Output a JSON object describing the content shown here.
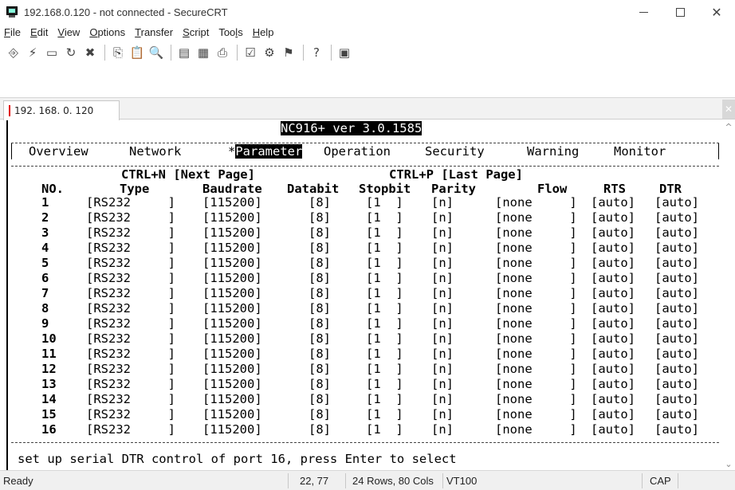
{
  "window": {
    "title": "192.168.0.120 - not connected - SecureCRT",
    "minimize_icon": "minimize-icon",
    "maximize_icon": "maximize-icon",
    "close_icon": "close-icon"
  },
  "menu": [
    {
      "pre": "",
      "mnemonic": "F",
      "post": "ile"
    },
    {
      "pre": "",
      "mnemonic": "E",
      "post": "dit"
    },
    {
      "pre": "",
      "mnemonic": "V",
      "post": "iew"
    },
    {
      "pre": "",
      "mnemonic": "O",
      "post": "ptions"
    },
    {
      "pre": "",
      "mnemonic": "T",
      "post": "ransfer"
    },
    {
      "pre": "",
      "mnemonic": "S",
      "post": "cript"
    },
    {
      "pre": "Too",
      "mnemonic": "l",
      "post": "s"
    },
    {
      "pre": "",
      "mnemonic": "H",
      "post": "elp"
    }
  ],
  "toolbar": {
    "groups": [
      [
        "connect-icon",
        "quick-connect-icon",
        "connect-in-tab-icon",
        "reconnect-icon",
        "disconnect-icon"
      ],
      [
        "copy-icon",
        "paste-icon",
        "find-icon"
      ],
      [
        "print-screen-icon",
        "print-selection-icon",
        "print-icon"
      ],
      [
        "session-options-icon",
        "global-options-icon",
        "keymap-icon"
      ],
      [
        "help-icon"
      ],
      [
        "sftp-icon"
      ]
    ]
  },
  "tab": {
    "label": "192. 168. 0. 120",
    "close_glyph": "✕"
  },
  "terminal": {
    "header": "NC916+ ver 3.0.1585",
    "nav_tabs": [
      "Overview",
      "Network",
      "*Parameter",
      "Operation",
      "Security",
      "Warning",
      "Monitor"
    ],
    "active_tab": "Parameter",
    "next_page": "CTRL+N [Next Page]",
    "last_page": "CTRL+P [Last Page]",
    "columns": {
      "no": "NO.",
      "type": "Type",
      "baudrate": "Baudrate",
      "databit": "Databit",
      "stopbit": "Stopbit",
      "parity": "Parity",
      "flow": "Flow",
      "rts": "RTS",
      "dtr": "DTR"
    },
    "rows": [
      {
        "no": "1",
        "type": "[RS232     ]",
        "baud": "[115200]",
        "databit": "[8]",
        "stopbit": "[1  ]",
        "parity": "[n]",
        "flow": "[none     ]",
        "rts": "[auto]",
        "dtr": "[auto]"
      },
      {
        "no": "2",
        "type": "[RS232     ]",
        "baud": "[115200]",
        "databit": "[8]",
        "stopbit": "[1  ]",
        "parity": "[n]",
        "flow": "[none     ]",
        "rts": "[auto]",
        "dtr": "[auto]"
      },
      {
        "no": "3",
        "type": "[RS232     ]",
        "baud": "[115200]",
        "databit": "[8]",
        "stopbit": "[1  ]",
        "parity": "[n]",
        "flow": "[none     ]",
        "rts": "[auto]",
        "dtr": "[auto]"
      },
      {
        "no": "4",
        "type": "[RS232     ]",
        "baud": "[115200]",
        "databit": "[8]",
        "stopbit": "[1  ]",
        "parity": "[n]",
        "flow": "[none     ]",
        "rts": "[auto]",
        "dtr": "[auto]"
      },
      {
        "no": "5",
        "type": "[RS232     ]",
        "baud": "[115200]",
        "databit": "[8]",
        "stopbit": "[1  ]",
        "parity": "[n]",
        "flow": "[none     ]",
        "rts": "[auto]",
        "dtr": "[auto]"
      },
      {
        "no": "6",
        "type": "[RS232     ]",
        "baud": "[115200]",
        "databit": "[8]",
        "stopbit": "[1  ]",
        "parity": "[n]",
        "flow": "[none     ]",
        "rts": "[auto]",
        "dtr": "[auto]"
      },
      {
        "no": "7",
        "type": "[RS232     ]",
        "baud": "[115200]",
        "databit": "[8]",
        "stopbit": "[1  ]",
        "parity": "[n]",
        "flow": "[none     ]",
        "rts": "[auto]",
        "dtr": "[auto]"
      },
      {
        "no": "8",
        "type": "[RS232     ]",
        "baud": "[115200]",
        "databit": "[8]",
        "stopbit": "[1  ]",
        "parity": "[n]",
        "flow": "[none     ]",
        "rts": "[auto]",
        "dtr": "[auto]"
      },
      {
        "no": "9",
        "type": "[RS232     ]",
        "baud": "[115200]",
        "databit": "[8]",
        "stopbit": "[1  ]",
        "parity": "[n]",
        "flow": "[none     ]",
        "rts": "[auto]",
        "dtr": "[auto]"
      },
      {
        "no": "10",
        "type": "[RS232     ]",
        "baud": "[115200]",
        "databit": "[8]",
        "stopbit": "[1  ]",
        "parity": "[n]",
        "flow": "[none     ]",
        "rts": "[auto]",
        "dtr": "[auto]"
      },
      {
        "no": "11",
        "type": "[RS232     ]",
        "baud": "[115200]",
        "databit": "[8]",
        "stopbit": "[1  ]",
        "parity": "[n]",
        "flow": "[none     ]",
        "rts": "[auto]",
        "dtr": "[auto]"
      },
      {
        "no": "12",
        "type": "[RS232     ]",
        "baud": "[115200]",
        "databit": "[8]",
        "stopbit": "[1  ]",
        "parity": "[n]",
        "flow": "[none     ]",
        "rts": "[auto]",
        "dtr": "[auto]"
      },
      {
        "no": "13",
        "type": "[RS232     ]",
        "baud": "[115200]",
        "databit": "[8]",
        "stopbit": "[1  ]",
        "parity": "[n]",
        "flow": "[none     ]",
        "rts": "[auto]",
        "dtr": "[auto]"
      },
      {
        "no": "14",
        "type": "[RS232     ]",
        "baud": "[115200]",
        "databit": "[8]",
        "stopbit": "[1  ]",
        "parity": "[n]",
        "flow": "[none     ]",
        "rts": "[auto]",
        "dtr": "[auto]"
      },
      {
        "no": "15",
        "type": "[RS232     ]",
        "baud": "[115200]",
        "databit": "[8]",
        "stopbit": "[1  ]",
        "parity": "[n]",
        "flow": "[none     ]",
        "rts": "[auto]",
        "dtr": "[auto]"
      },
      {
        "no": "16",
        "type": "[RS232     ]",
        "baud": "[115200]",
        "databit": "[8]",
        "stopbit": "[1  ]",
        "parity": "[n]",
        "flow": "[none     ]",
        "rts": "[auto]",
        "dtr": "[auto]"
      }
    ],
    "help_line": "set up serial DTR control of port 16, press Enter to select"
  },
  "statusbar": {
    "ready": "Ready",
    "cursor": "22, 77",
    "size": "24 Rows, 80 Cols",
    "emulation": "VT100",
    "caps": "CAP"
  },
  "colors": {
    "tab_marker": "#e00000",
    "terminal_bg": "#ffffff",
    "terminal_fg": "#000000"
  }
}
